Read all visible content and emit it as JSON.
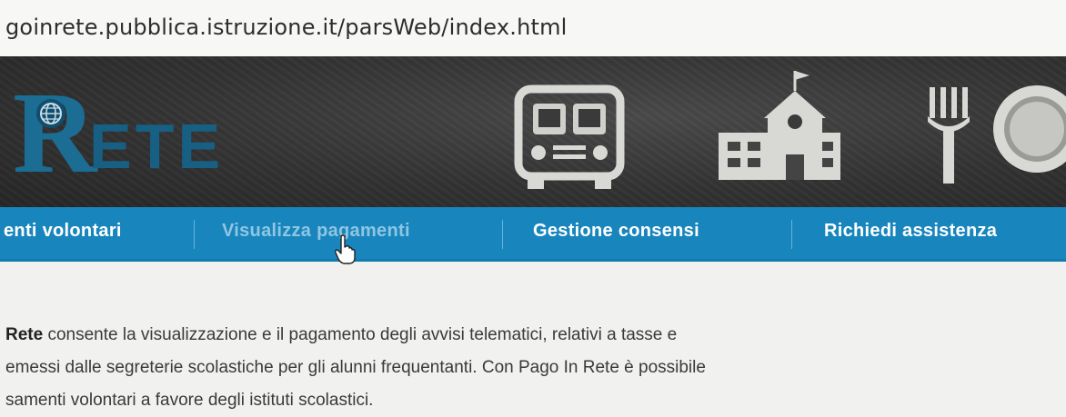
{
  "browser": {
    "url": "goinrete.pubblica.istruzione.it/parsWeb/index.html"
  },
  "header": {
    "logo_text": "RETE",
    "icons": [
      "globe-icon",
      "school-bus-icon",
      "school-building-icon",
      "fork-plate-icon"
    ],
    "colors": {
      "banner": "#333333",
      "logo": "#1c6d93"
    }
  },
  "nav": {
    "items": [
      {
        "label": "enti volontari"
      },
      {
        "label": "Visualizza pagamenti"
      },
      {
        "label": "Gestione consensi"
      },
      {
        "label": "Richiedi assistenza"
      }
    ],
    "colors": {
      "background": "#1886bd",
      "text": "#ffffff",
      "hover_text": "#8fc6e2"
    }
  },
  "content": {
    "line1_bold": "Rete",
    "line1_rest": " consente la visualizzazione e il pagamento degli avvisi telematici, relativi a tasse e",
    "line2": "emessi dalle segreterie scolastiche per gli alunni frequentanti. Con Pago In Rete è possibile",
    "line3": "samenti volontari a favore degli istituti scolastici."
  }
}
